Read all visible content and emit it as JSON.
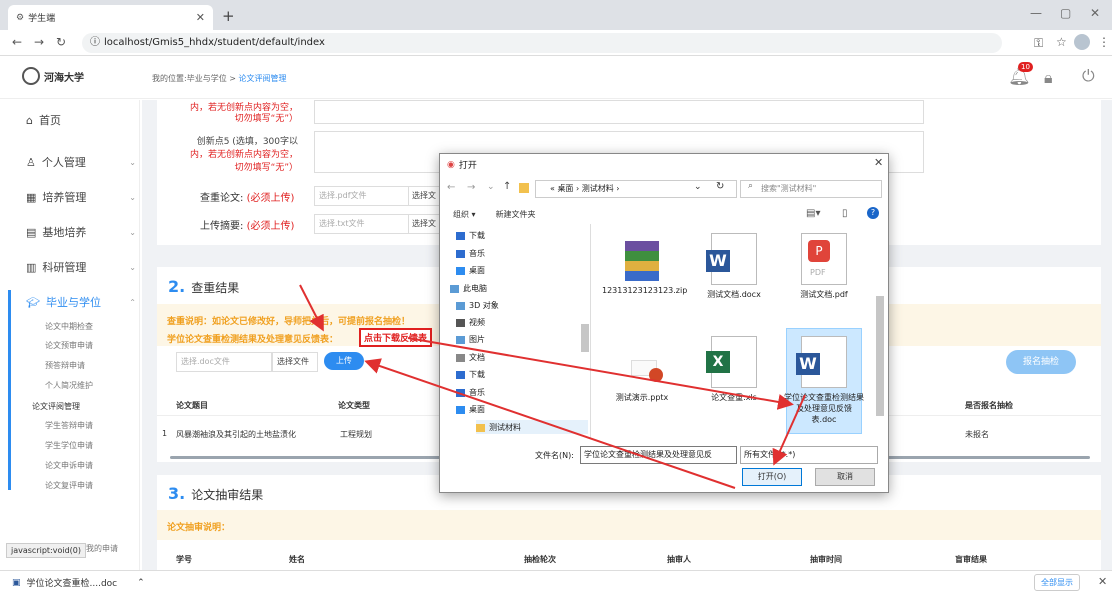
{
  "browser": {
    "tab_title": "学生端",
    "url": "localhost/Gmis5_hhdx/student/default/index",
    "status_text": "javascript:void(0)"
  },
  "app": {
    "logo_text": "河海大学",
    "breadcrumb_prefix": "我的位置:毕业与学位 > ",
    "breadcrumb_current": "论文评阅管理",
    "notification_count": "10"
  },
  "sidebar": {
    "items": [
      {
        "label": "首页"
      },
      {
        "label": "个人管理"
      },
      {
        "label": "培养管理"
      },
      {
        "label": "基地培养"
      },
      {
        "label": "科研管理"
      },
      {
        "label": "毕业与学位"
      }
    ],
    "sub_items": [
      "论文中期检查",
      "论文预审申请",
      "预答辩申请",
      "个人简况维护",
      "论文评阅管理",
      "学生答辩申请",
      "学生学位申请",
      "论文申诉申请",
      "论文复评申请"
    ],
    "bottom_item": "我的申请"
  },
  "form": {
    "cut_text_1": "内，若无创新点内容为空，",
    "cut_text_2": "切勿填写“无”）",
    "innovation5_line1": "创新点5 (选填，300字以",
    "innovation5_line2": "内，若无创新点内容为空，",
    "innovation5_line3": "切勿填写“无”）",
    "check_label": "查重论文:",
    "check_req": "(必须上传)",
    "check_placeholder": "选择.pdf文件",
    "abstract_label": "上传摘要:",
    "abstract_req": "(必须上传)",
    "abstract_placeholder": "选择.txt文件",
    "choose_file_short": "选择文"
  },
  "section2": {
    "num": "2.",
    "title": "查重结果",
    "note1": "查重说明：如论文已修改好，导师把关后，可提前报名抽检！",
    "note2": "学位论文查重检测结果及处理意见反馈表：",
    "download_link": "点击下载反馈表",
    "upload_placeholder": "选择.doc文件",
    "choose_file": "选择文件",
    "upload_btn": "上传",
    "signup_btn": "报名抽检",
    "headers": [
      "论文题目",
      "论文类型",
      "是否报名抽检"
    ],
    "row": {
      "index": "1",
      "title": "风暴潮袖浪及其引起的土地盐渍化",
      "type": "工程规划",
      "status": "未报名"
    }
  },
  "section3": {
    "num": "3.",
    "title": "论文抽审结果",
    "note": "论文抽审说明：",
    "headers": [
      "学号",
      "姓名",
      "抽检轮次",
      "抽审人",
      "抽审时间",
      "盲审结果"
    ]
  },
  "download_bar": {
    "file": "学位论文查重检....doc",
    "show_all": "全部显示"
  },
  "dialog": {
    "title": "打开",
    "path": "« 桌面 › 测试材料 ›",
    "search_placeholder": "搜索\"测试材料\"",
    "organize": "组织 ▾",
    "new_folder": "新建文件夹",
    "nav": [
      {
        "label": "下载",
        "color": "#2d6ccf"
      },
      {
        "label": "音乐",
        "color": "#2d6ccf"
      },
      {
        "label": "桌面",
        "color": "#2d8cf0"
      },
      {
        "label": "此电脑",
        "color": "#5b9bd5"
      },
      {
        "label": "3D 对象",
        "color": "#5b9bd5"
      },
      {
        "label": "视频",
        "color": "#555"
      },
      {
        "label": "图片",
        "color": "#5b9bd5"
      },
      {
        "label": "文档",
        "color": "#888"
      },
      {
        "label": "下载",
        "color": "#2d6ccf"
      },
      {
        "label": "音乐",
        "color": "#2d6ccf"
      },
      {
        "label": "桌面",
        "color": "#2d8cf0"
      },
      {
        "label": "测试材料",
        "color": "#f2c14e"
      }
    ],
    "files": [
      {
        "name": "12313123123123.zip",
        "icon": "zip-icon"
      },
      {
        "name": "测试文档.docx",
        "icon": "word-icon"
      },
      {
        "name": "测试文档.pdf",
        "icon": "pdf-icon"
      },
      {
        "name": "测试演示.pptx",
        "icon": "ppt-icon"
      },
      {
        "name": "论文查重.xls",
        "icon": "excel-icon"
      },
      {
        "name": "学位论文查重检测结果及处理意见反馈表.doc",
        "icon": "word-icon"
      }
    ],
    "filename_label": "文件名(N):",
    "filename_value": "学位论文查重检测结果及处理意见反",
    "filetype": "所有文件 (*.*)",
    "open_btn": "打开(O)",
    "cancel_btn": "取消"
  },
  "colors": {
    "accent": "#2d8cf0",
    "warning": "#f0a020",
    "danger": "#e02020",
    "annotation": "#e03030"
  }
}
